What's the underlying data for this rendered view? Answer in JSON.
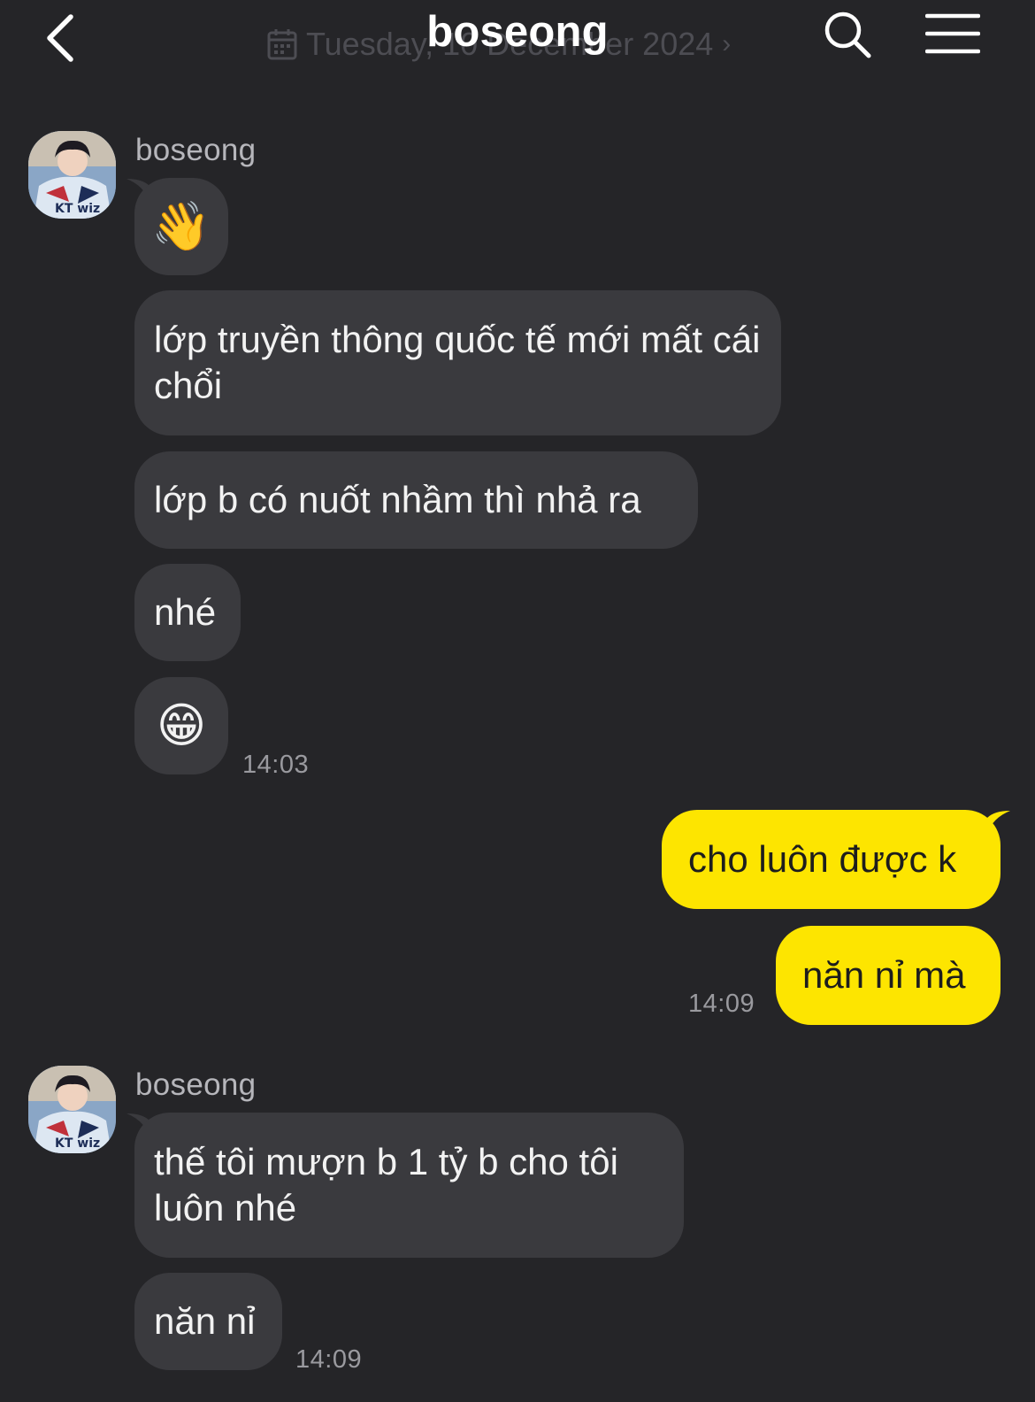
{
  "header": {
    "title": "boseong",
    "date_ghost": "Tuesday, 10 December 2024",
    "back_icon": "chevron-left-icon",
    "search_icon": "search-icon",
    "menu_icon": "hamburger-menu-icon"
  },
  "colors": {
    "background": "#252528",
    "incoming_bubble": "#3a3a3e",
    "outgoing_bubble": "#fde500",
    "timestamp": "#9a9a9f"
  },
  "messages": {
    "group1": {
      "sender": "boseong",
      "m1_icon": "waving-hand-emoji",
      "m2": "lớp truyền thông quốc tế mới mất cái chổi",
      "m3": "lớp b có nuốt nhầm thì nhả ra",
      "m4": "nhé",
      "m5_icon": "grinning-face-emoji",
      "time": "14:03"
    },
    "group2": {
      "m1": "cho luôn được k",
      "m2": "năn nỉ mà",
      "time": "14:09"
    },
    "group3": {
      "sender": "boseong",
      "m1": "thế tôi mượn b 1 tỷ b cho tôi luôn nhé",
      "m2": "năn nỉ",
      "time": "14:09"
    }
  }
}
